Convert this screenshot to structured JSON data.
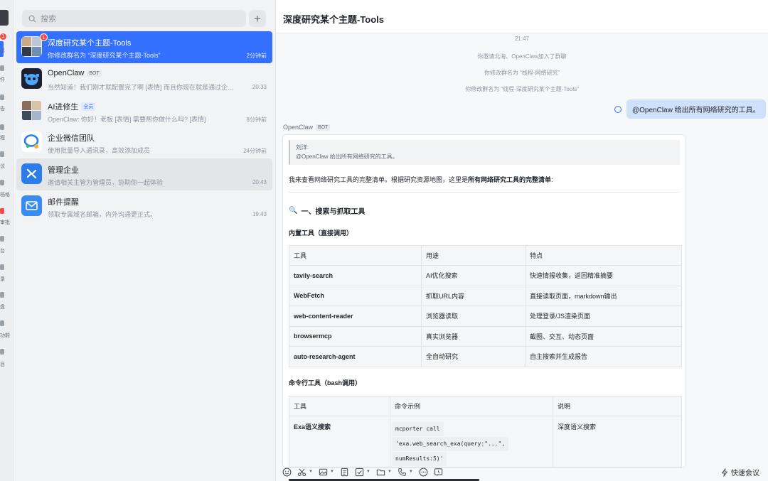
{
  "rail": {
    "badge": "1",
    "labels": [
      "息",
      "件",
      "告",
      "程",
      "议",
      "档格",
      "审批",
      "台",
      "录",
      "盘",
      "功能",
      "目"
    ]
  },
  "search": {
    "placeholder": "搜索",
    "add": "+"
  },
  "conversations": [
    {
      "name": "深度研究某个主题-Tools",
      "preview": "你修改群名为 “深度研究某个主题-Tools”",
      "time": "2分钟前",
      "badge": "1"
    },
    {
      "name": "OpenClaw",
      "tag": "BOT",
      "preview": "当然知道！我们刚才就配置完了啊 [表情] 而且你现在就是通过企业微信...",
      "time": "20:33"
    },
    {
      "name": "AI进修生",
      "tag": "全员",
      "preview": "OpenClaw: 你好！老板 [表情] 需要帮你做什么吗? [表情]",
      "time": "8分钟前"
    },
    {
      "name": "企业微信团队",
      "preview": "使用批量导入通讯录，高效添加成员",
      "time": "24分钟前"
    },
    {
      "name": "管理企业",
      "preview": "邀请相关主管为管理员，协助你一起体验",
      "time": "20:43"
    },
    {
      "name": "邮件提醒",
      "preview": "领取专属域名邮箱，内外沟通更正式。",
      "time": "19:43"
    }
  ],
  "chat": {
    "title": "深度研究某个主题-Tools",
    "system": [
      "21:47",
      "你邀请北海、OpenClaw加入了群聊",
      "你修改群名为 “线程-网络研究”",
      "你修改群名为 “线程-深度研究某个主题-Tools”"
    ],
    "my_message": "@OpenClaw 给出所有网络研究的工具。",
    "sender": "OpenClaw",
    "sender_tag": "BOT",
    "quote_author": "刘洋:",
    "quote_text": "@OpenClaw  给出所有网络研究的工具。",
    "intro_plain": "我来查看网络研究工具的完整清单。根据研究资源地图，这里是",
    "intro_bold": "所有网络研究工具的完整清单",
    "intro_tail": ":",
    "section1_icon": "🔍",
    "section1": "一、搜索与抓取工具",
    "sub1": "内置工具（直接调用）",
    "table1": {
      "headers": [
        "工具",
        "用途",
        "特点"
      ],
      "rows": [
        [
          "tavily-search",
          "AI优化搜索",
          "快速情报收集，返回精准摘要"
        ],
        [
          "WebFetch",
          "抓取URL内容",
          "直接读取页面，markdown输出"
        ],
        [
          "web-content-reader",
          "浏览器读取",
          "处理登录/JS渲染页面"
        ],
        [
          "browsermcp",
          "真实浏览器",
          "截图、交互、动态页面"
        ],
        [
          "auto-research-agent",
          "全自动研究",
          "自主搜索并生成报告"
        ]
      ]
    },
    "sub2": "命令行工具（bash调用）",
    "table2": {
      "headers": [
        "工具",
        "命令示例",
        "说明"
      ],
      "rows": [
        [
          "Exa语义搜索",
          "mcporter call",
          "'exa.web_search_exa(query:\"...\",",
          "numResults:5)'",
          "深度语义搜索"
        ]
      ]
    },
    "meeting": "快速会议"
  }
}
